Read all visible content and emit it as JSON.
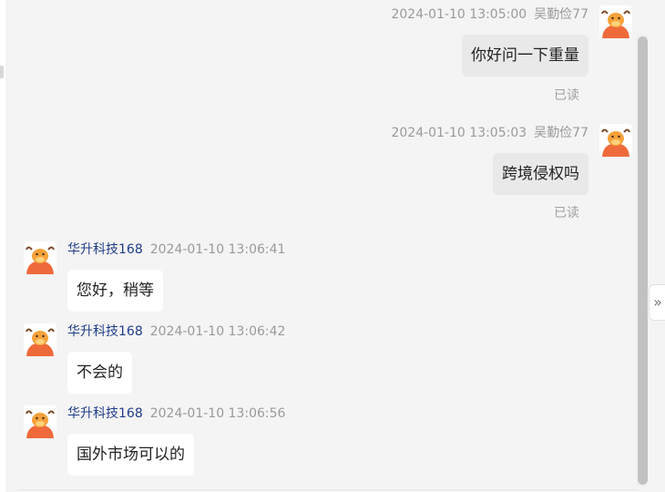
{
  "messages": [
    {
      "direction": "out",
      "sender": "吴勤俭77",
      "time": "2024-01-10 13:05:00",
      "text": "你好问一下重量",
      "status": "已读"
    },
    {
      "direction": "out",
      "sender": "吴勤俭77",
      "time": "2024-01-10 13:05:03",
      "text": "跨境侵权吗",
      "status": "已读"
    },
    {
      "direction": "in",
      "sender": "华升科技168",
      "time": "2024-01-10 13:06:41",
      "text": "您好，稍等"
    },
    {
      "direction": "in",
      "sender": "华升科技168",
      "time": "2024-01-10 13:06:42",
      "text": "不会的"
    },
    {
      "direction": "in",
      "sender": "华升科技168",
      "time": "2024-01-10 13:06:56",
      "text": "国外市场可以的"
    }
  ],
  "ui": {
    "expand_icon": "»"
  },
  "colors": {
    "agent_name": "#1f3c88",
    "incoming_bubble": "#ffffff",
    "outgoing_bubble": "#e9e9e9",
    "avatar_orange": "#f07a3c"
  }
}
